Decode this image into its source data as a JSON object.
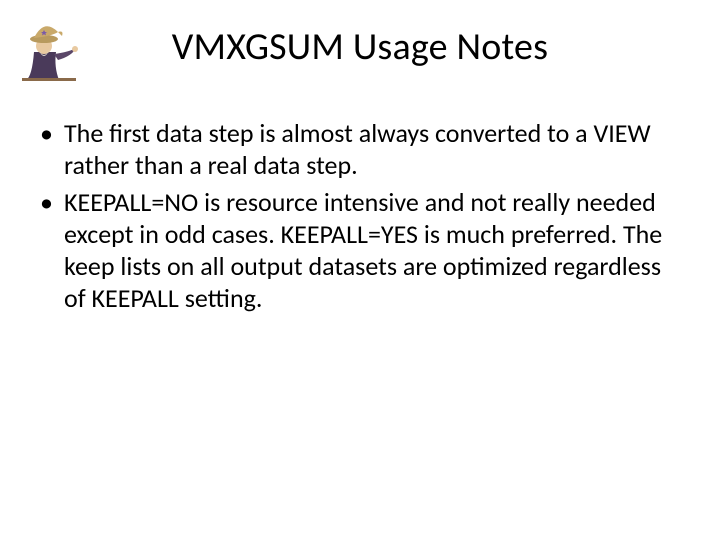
{
  "slide": {
    "title": "VMXGSUM Usage Notes",
    "bullets": [
      "The first data step is almost always converted to a VIEW rather than a real data step.",
      "KEEPALL=NO is resource intensive and not really needed except in odd cases.  KEEPALL=YES is much preferred.  The keep lists on all output datasets are optimized regardless of KEEPALL setting."
    ],
    "logo_alt": "wizard-logo"
  }
}
